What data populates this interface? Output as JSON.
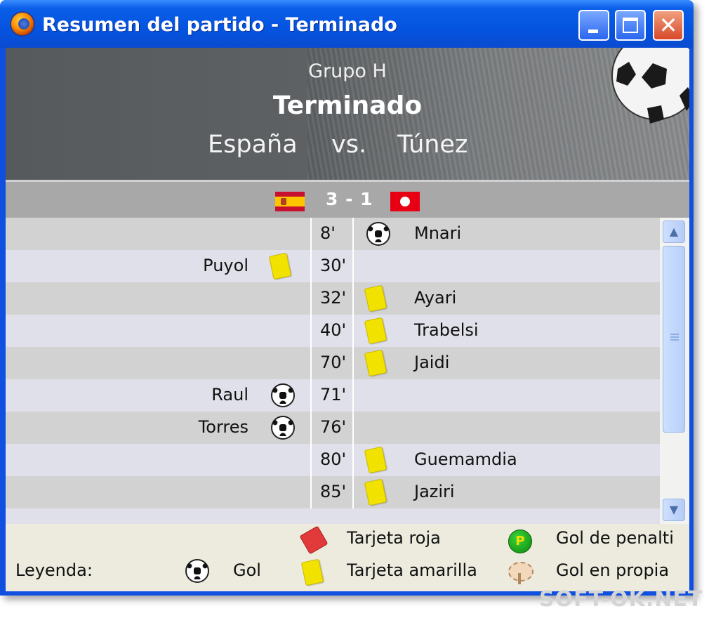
{
  "window": {
    "title": "Resumen del partido - Terminado"
  },
  "header": {
    "group": "Grupo H",
    "status": "Terminado",
    "team_home": "España",
    "vs": "vs.",
    "team_away": "Túnez"
  },
  "score": {
    "text": "3 - 1",
    "home_flag": "spain-flag-icon",
    "away_flag": "tunisia-flag-icon"
  },
  "events": [
    {
      "minute": "8'",
      "home_player": "",
      "home_icon": "",
      "away_player": "Mnari",
      "away_icon": "ball"
    },
    {
      "minute": "30'",
      "home_player": "Puyol",
      "home_icon": "yellow-card",
      "away_player": "",
      "away_icon": ""
    },
    {
      "minute": "32'",
      "home_player": "",
      "home_icon": "",
      "away_player": "Ayari",
      "away_icon": "yellow-card"
    },
    {
      "minute": "40'",
      "home_player": "",
      "home_icon": "",
      "away_player": "Trabelsi",
      "away_icon": "yellow-card"
    },
    {
      "minute": "70'",
      "home_player": "",
      "home_icon": "",
      "away_player": "Jaidi",
      "away_icon": "yellow-card"
    },
    {
      "minute": "71'",
      "home_player": "Raul",
      "home_icon": "ball",
      "away_player": "",
      "away_icon": ""
    },
    {
      "minute": "76'",
      "home_player": "Torres",
      "home_icon": "ball",
      "away_player": "",
      "away_icon": ""
    },
    {
      "minute": "80'",
      "home_player": "",
      "home_icon": "",
      "away_player": "Guemamdia",
      "away_icon": "yellow-card"
    },
    {
      "minute": "85'",
      "home_player": "",
      "home_icon": "",
      "away_player": "Jaziri",
      "away_icon": "yellow-card"
    }
  ],
  "legend": {
    "label": "Leyenda:",
    "goal": "Gol",
    "red_card": "Tarjeta roja",
    "yellow_card": "Tarjeta amarilla",
    "penalty_goal": "Gol de penalti",
    "own_goal": "Gol en propia"
  },
  "watermark": "SOFT-OK.NET",
  "colors": {
    "titlebar": "#0454e0",
    "header_bg": "#5e6163",
    "scorebar_bg": "#a8a8a8",
    "row_odd": "#d2d2d2",
    "row_even": "#e0e0ea",
    "yellow_card": "#f2e200",
    "red_card": "#e23a3a"
  }
}
